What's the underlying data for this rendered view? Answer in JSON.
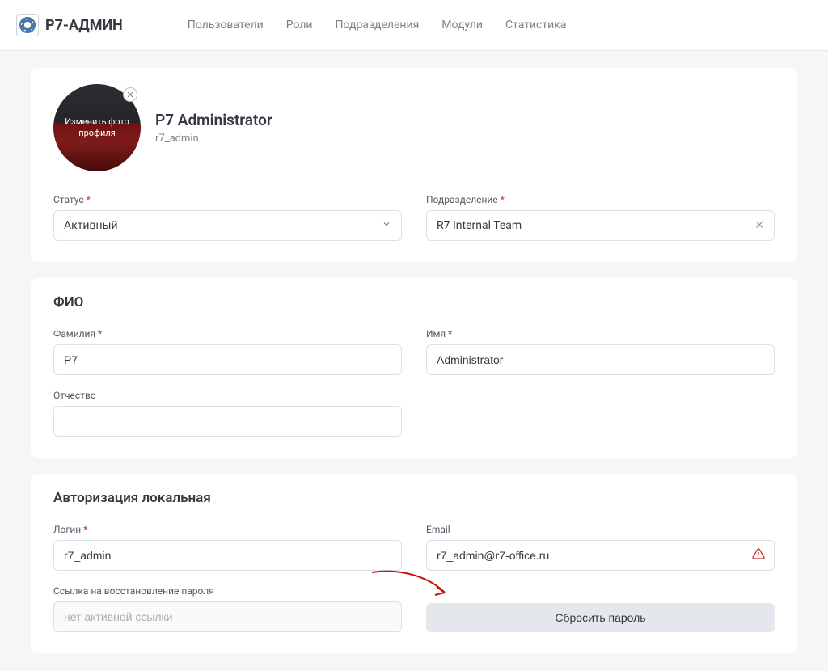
{
  "brand": "Р7-АДМИН",
  "nav": {
    "users": "Пользователи",
    "roles": "Роли",
    "departments": "Подразделения",
    "modules": "Модули",
    "stats": "Статистика"
  },
  "profile": {
    "avatar_overlay": "Изменить фото профиля",
    "display_name": "P7 Administrator",
    "username": "r7_admin"
  },
  "status": {
    "label": "Статус",
    "value": "Активный"
  },
  "department": {
    "label": "Подразделение",
    "value": "R7 Internal Team"
  },
  "fio": {
    "section": "ФИО",
    "lastname_label": "Фамилия",
    "lastname_value": "P7",
    "firstname_label": "Имя",
    "firstname_value": "Administrator",
    "patronymic_label": "Отчество",
    "patronymic_value": ""
  },
  "auth": {
    "section": "Авторизация локальная",
    "login_label": "Логин",
    "login_value": "r7_admin",
    "email_label": "Email",
    "email_value": "r7_admin@r7-office.ru",
    "reset_link_label": "Ссылка на восстановление пароля",
    "reset_link_placeholder": "нет активной ссылки",
    "reset_button": "Сбросить пароль"
  }
}
